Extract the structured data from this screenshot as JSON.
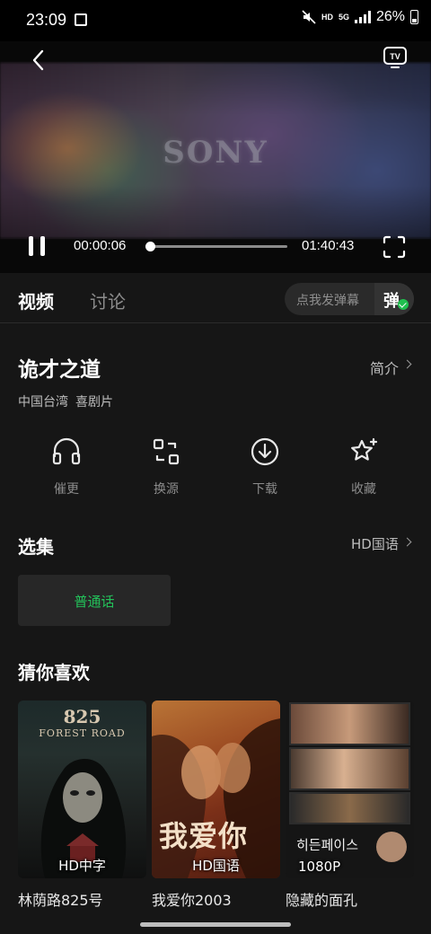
{
  "status_bar": {
    "time": "23:09",
    "network_label": "HD",
    "network_type": "5G",
    "battery": "26%"
  },
  "player": {
    "brand_logo": "SONY",
    "current_time": "00:00:06",
    "total_time": "01:40:43",
    "progress_fraction": 0.0,
    "state": "playing"
  },
  "tabs": [
    {
      "label": "视频",
      "active": true
    },
    {
      "label": "讨论",
      "active": false
    }
  ],
  "danmu": {
    "placeholder": "点我发弹幕",
    "button_label": "弹"
  },
  "show": {
    "title": "诡才之道",
    "intro_link": "简介",
    "region": "中国台湾",
    "genre": "喜剧片"
  },
  "actions": [
    {
      "label": "催更",
      "icon": "headphones-icon"
    },
    {
      "label": "换源",
      "icon": "switch-source-icon"
    },
    {
      "label": "下载",
      "icon": "download-icon"
    },
    {
      "label": "收藏",
      "icon": "star-icon"
    }
  ],
  "episodes": {
    "section_title": "选集",
    "language": "HD国语",
    "items": [
      {
        "label": "普通话"
      }
    ]
  },
  "recommend": {
    "section_title": "猜你喜欢",
    "items": [
      {
        "title": "林荫路825号",
        "badge": "HD中字",
        "poster_lines": [
          "825",
          "FOREST ROAD"
        ]
      },
      {
        "title": "我爱你2003",
        "badge": "HD国语",
        "poster_lines": [
          "我爱你"
        ]
      },
      {
        "title": "隐藏的面孔",
        "badge": "1080P",
        "poster_lines": [
          "히든페이스"
        ]
      }
    ]
  },
  "colors": {
    "accent_green": "#23c25a",
    "background": "#161616",
    "card": "#272727"
  }
}
